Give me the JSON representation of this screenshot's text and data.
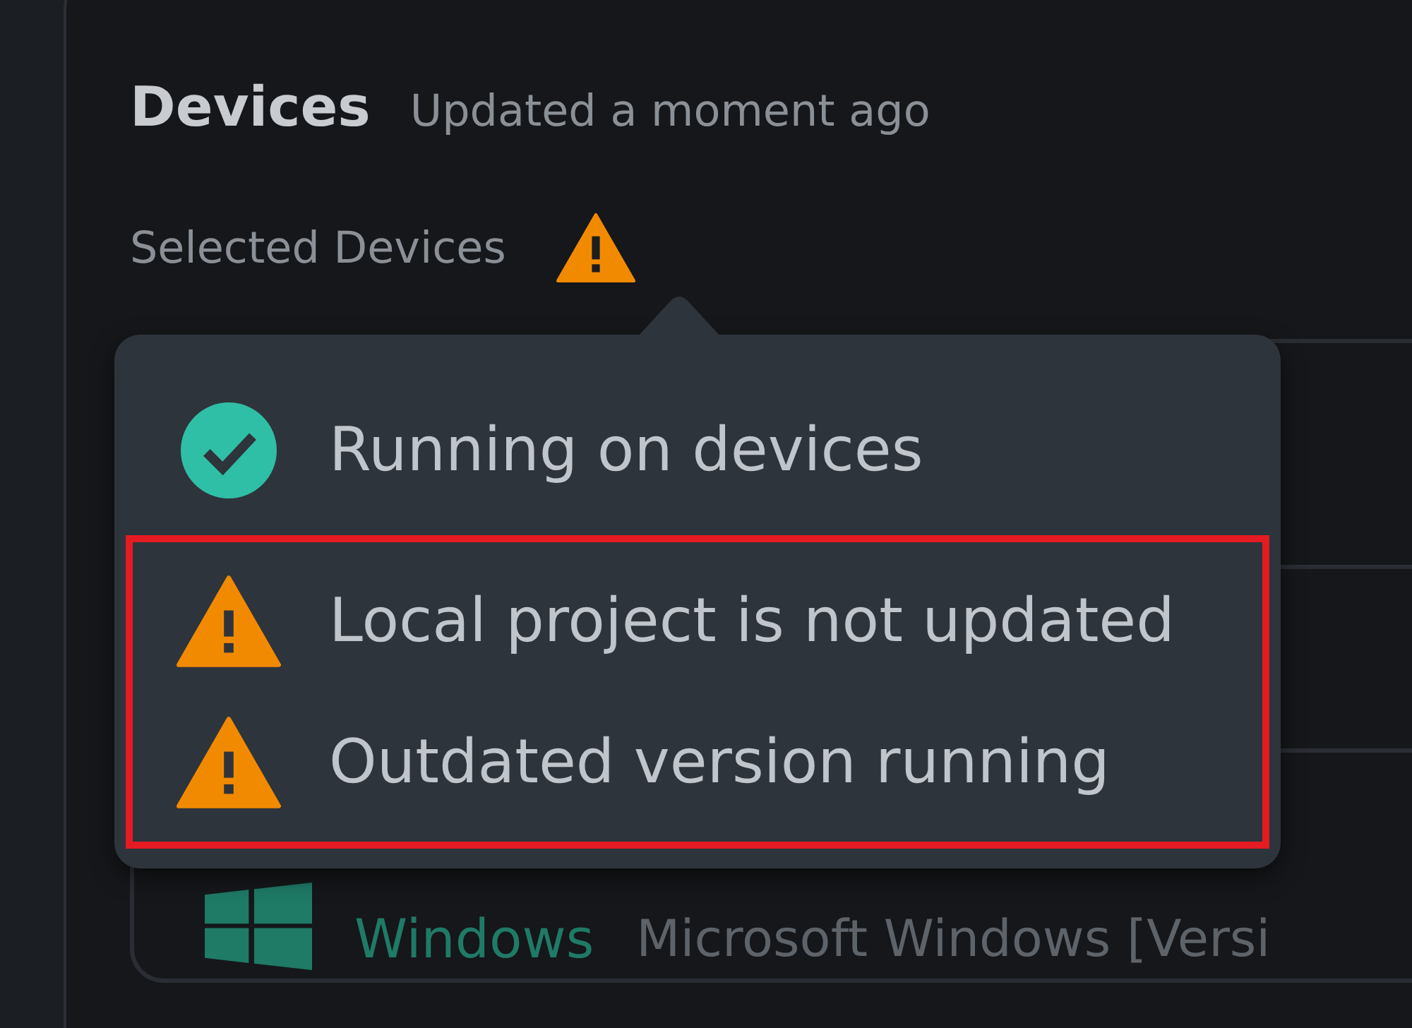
{
  "header": {
    "title": "Devices",
    "updated": "Updated a moment ago"
  },
  "selected_devices": {
    "label": "Selected Devices",
    "warning": true
  },
  "status_popover": {
    "items": [
      {
        "kind": "success",
        "label": "Running on devices",
        "highlighted": false
      },
      {
        "kind": "warning",
        "label": "Local project is not updated",
        "highlighted": true
      },
      {
        "kind": "warning",
        "label": "Outdated version running",
        "highlighted": true
      }
    ]
  },
  "devices": [
    {
      "name": "Windows",
      "description": "Microsoft Windows [Versi"
    }
  ]
}
